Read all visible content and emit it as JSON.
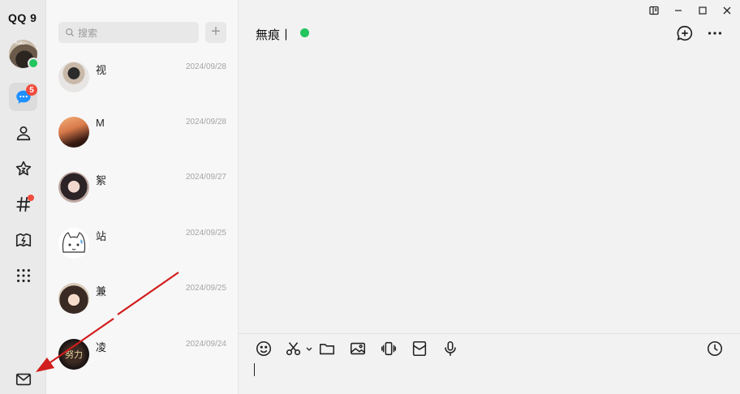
{
  "app": {
    "logo_text": "QQ 9"
  },
  "profile": {
    "avatar_text": "hello~"
  },
  "sidebar": {
    "items": [
      {
        "name": "messages",
        "badge": "5",
        "active": true
      },
      {
        "name": "contacts"
      },
      {
        "name": "favorites"
      },
      {
        "name": "channels",
        "has_dot": true
      },
      {
        "name": "games"
      },
      {
        "name": "more"
      }
    ],
    "bottom": {
      "name": "mail"
    }
  },
  "search": {
    "placeholder": "搜索"
  },
  "conversations": [
    {
      "name": "视",
      "date": "2024/09/28"
    },
    {
      "name": "M",
      "date": "2024/09/28"
    },
    {
      "name": "絮",
      "date": "2024/09/27"
    },
    {
      "name": "站",
      "date": "2024/09/25"
    },
    {
      "name": "兼",
      "date": "2024/09/25"
    },
    {
      "name": "凌",
      "date": "2024/09/24",
      "avatar_text": "努力"
    }
  ],
  "chat": {
    "title": "無痕丨",
    "status_color": "#22c55e"
  },
  "colors": {
    "accent": "#1e90ff",
    "badge": "#f24b3c",
    "online": "#22c55e",
    "annotation_arrow": "#d11d1d"
  }
}
